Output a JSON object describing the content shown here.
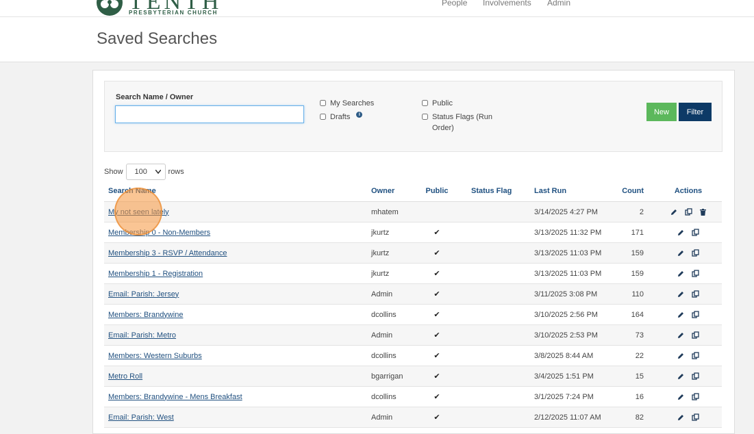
{
  "brand": {
    "name": "TENTH",
    "subtitle": "PRESBYTERIAN CHURCH"
  },
  "nav": {
    "items": [
      "People",
      "Involvements",
      "Admin"
    ]
  },
  "page": {
    "title": "Saved Searches"
  },
  "filter": {
    "label": "Search Name / Owner",
    "search_value": "",
    "checkboxes": {
      "my_searches": "My Searches",
      "drafts": "Drafts",
      "public": "Public",
      "status_flags": "Status Flags (Run Order)"
    },
    "new_label": "New",
    "filter_label": "Filter"
  },
  "show_rows": {
    "show": "Show",
    "value": "100",
    "rows": "rows"
  },
  "table": {
    "headers": [
      "Search Name",
      "Owner",
      "Public",
      "Status Flag",
      "Last Run",
      "Count",
      "Actions"
    ],
    "rows": [
      {
        "name": "My not seen lately",
        "owner": "mhatem",
        "public": false,
        "status": "",
        "last_run": "3/14/2025 4:27 PM",
        "count": "2",
        "can_delete": true
      },
      {
        "name": "Membership 0 - Non-Members",
        "owner": "jkurtz",
        "public": true,
        "status": "",
        "last_run": "3/13/2025 11:32 PM",
        "count": "171",
        "can_delete": false
      },
      {
        "name": "Membership 3 - RSVP / Attendance",
        "owner": "jkurtz",
        "public": true,
        "status": "",
        "last_run": "3/13/2025 11:03 PM",
        "count": "159",
        "can_delete": false
      },
      {
        "name": "Membership 1 - Registration",
        "owner": "jkurtz",
        "public": true,
        "status": "",
        "last_run": "3/13/2025 11:03 PM",
        "count": "159",
        "can_delete": false
      },
      {
        "name": "Email: Parish: Jersey",
        "owner": "Admin",
        "public": true,
        "status": "",
        "last_run": "3/11/2025 3:08 PM",
        "count": "110",
        "can_delete": false
      },
      {
        "name": "Members: Brandywine",
        "owner": "dcollins",
        "public": true,
        "status": "",
        "last_run": "3/10/2025 2:56 PM",
        "count": "164",
        "can_delete": false
      },
      {
        "name": "Email: Parish: Metro",
        "owner": "Admin",
        "public": true,
        "status": "",
        "last_run": "3/10/2025 2:53 PM",
        "count": "73",
        "can_delete": false
      },
      {
        "name": "Members: Western Suburbs",
        "owner": "dcollins",
        "public": true,
        "status": "",
        "last_run": "3/8/2025 8:44 AM",
        "count": "22",
        "can_delete": false
      },
      {
        "name": "Metro Roll",
        "owner": "bgarrigan",
        "public": true,
        "status": "",
        "last_run": "3/4/2025 1:51 PM",
        "count": "15",
        "can_delete": false
      },
      {
        "name": "Members: Brandywine - Mens Breakfast",
        "owner": "dcollins",
        "public": true,
        "status": "",
        "last_run": "3/1/2025 7:24 PM",
        "count": "16",
        "can_delete": false
      },
      {
        "name": "Email: Parish: West",
        "owner": "Admin",
        "public": true,
        "status": "",
        "last_run": "2/12/2025 11:07 AM",
        "count": "82",
        "can_delete": false
      }
    ]
  },
  "colors": {
    "brand_green": "#2f5e46",
    "new_button": "#5cb85c",
    "filter_button": "#0d3a66",
    "link": "#1f4f7f"
  },
  "icons": {
    "edit": "pencil-icon",
    "copy": "copy-icon",
    "delete": "trash-icon",
    "public": "check-icon",
    "info": "info-icon"
  }
}
